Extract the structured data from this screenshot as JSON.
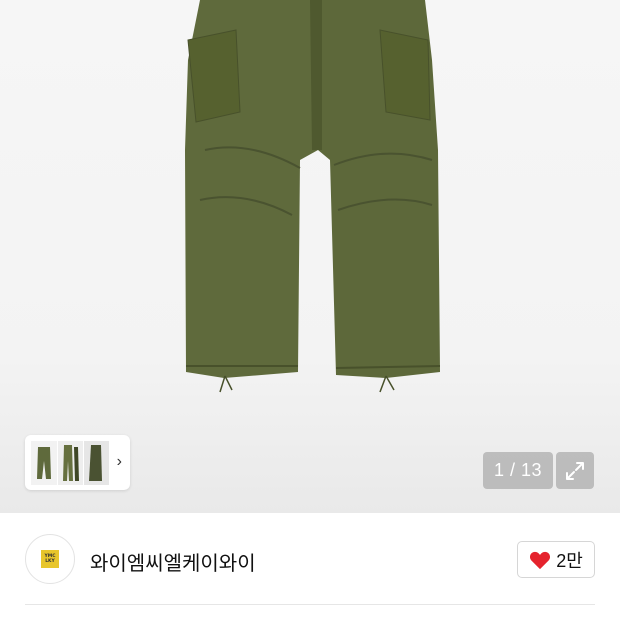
{
  "gallery": {
    "counter": "1 / 13",
    "icons": {
      "expand": "expand-arrows-icon",
      "next": "chevron-right-icon"
    },
    "colors": {
      "pants": "#5f6a3c",
      "pants_dark": "#48512b"
    }
  },
  "seller": {
    "logo_text_line1": "YMC",
    "logo_text_line2": "LKY",
    "name": "와이엠씨엘케이와이",
    "logo_color": "#e8c62c"
  },
  "like": {
    "count": "2만",
    "icon": "heart-icon",
    "icon_color": "#e5232d"
  }
}
